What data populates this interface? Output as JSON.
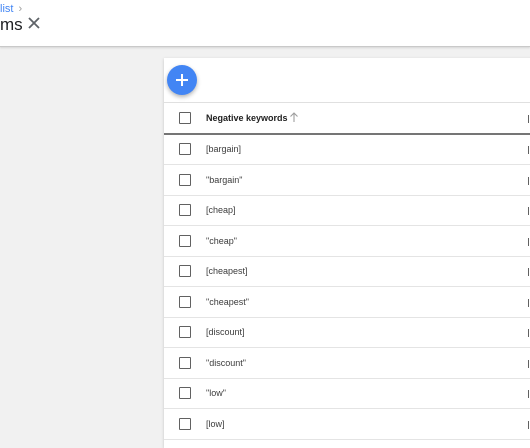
{
  "header": {
    "breadcrumb_label": "list",
    "breadcrumb_chevron": "›",
    "title": "ms",
    "close_icon": "close-icon"
  },
  "card": {
    "add_icon": "plus-icon",
    "table": {
      "column_header": "Negative keywords",
      "sort_icon": "arrow-up-icon",
      "rows": [
        {
          "keyword": "[bargain]"
        },
        {
          "keyword": "\"bargain\""
        },
        {
          "keyword": "[cheap]"
        },
        {
          "keyword": "\"cheap\""
        },
        {
          "keyword": "[cheapest]"
        },
        {
          "keyword": "\"cheapest\""
        },
        {
          "keyword": "[discount]"
        },
        {
          "keyword": "\"discount\""
        },
        {
          "keyword": "\"low\""
        },
        {
          "keyword": "[low]"
        }
      ]
    }
  },
  "colors": {
    "accent": "#4285f4",
    "background": "#f1f1f1",
    "card": "#ffffff"
  }
}
